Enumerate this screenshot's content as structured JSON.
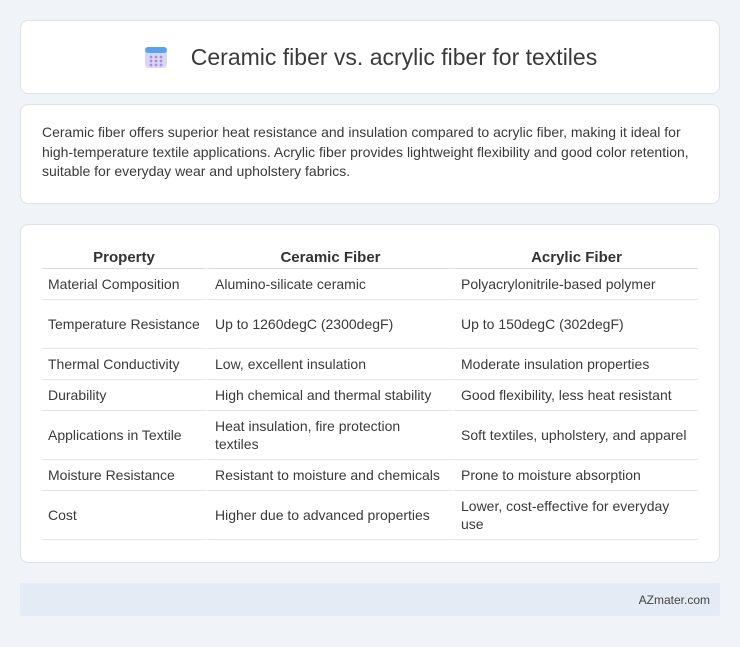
{
  "header": {
    "title": "Ceramic fiber vs. acrylic fiber for textiles",
    "icon": "calendar-icon"
  },
  "intro": {
    "text": "Ceramic fiber offers superior heat resistance and insulation compared to acrylic fiber, making it ideal for high-temperature textile applications. Acrylic fiber provides lightweight flexibility and good color retention, suitable for everyday wear and upholstery fabrics."
  },
  "table": {
    "headers": [
      "Property",
      "Ceramic Fiber",
      "Acrylic Fiber"
    ],
    "rows": [
      [
        "Material Composition",
        "Alumino-silicate ceramic",
        "Polyacrylonitrile-based polymer"
      ],
      [
        "Temperature Resistance",
        "Up to 1260degC (2300degF)",
        "Up to 150degC (302degF)"
      ],
      [
        "Thermal Conductivity",
        "Low, excellent insulation",
        "Moderate insulation properties"
      ],
      [
        "Durability",
        "High chemical and thermal stability",
        "Good flexibility, less heat resistant"
      ],
      [
        "Applications in Textile",
        "Heat insulation, fire protection textiles",
        "Soft textiles, upholstery, and apparel"
      ],
      [
        "Moisture Resistance",
        "Resistant to moisture and chemicals",
        "Prone to moisture absorption"
      ],
      [
        "Cost",
        "Higher due to advanced properties",
        "Lower, cost-effective for everyday use"
      ]
    ]
  },
  "footer": {
    "site": "AZmater.com"
  }
}
